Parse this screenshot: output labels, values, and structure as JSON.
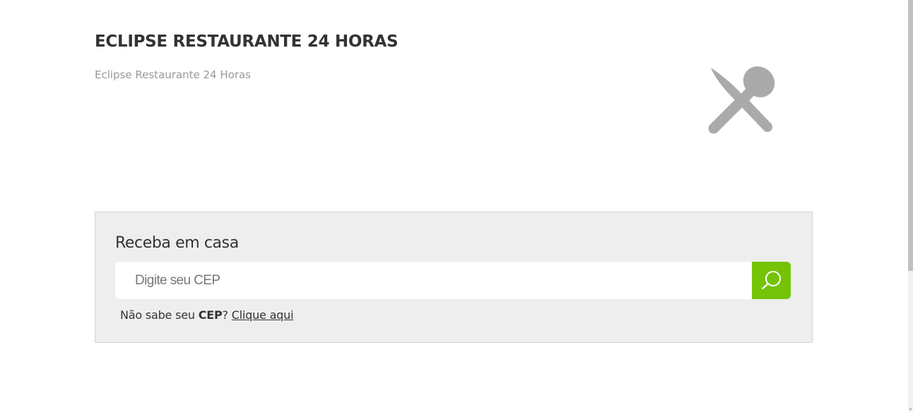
{
  "header": {
    "title": "ECLIPSE RESTAURANTE 24 HORAS",
    "subtitle": "Eclipse Restaurante 24 Horas",
    "logo_icon": "fork-spoon-crossed-icon",
    "logo_color": "#aaaaaa"
  },
  "delivery": {
    "title": "Receba em casa",
    "cep_placeholder": "Digite seu CEP",
    "cep_value": "",
    "search_icon": "search-icon",
    "search_button_color": "#74c306",
    "helper_prefix": "Não sabe seu ",
    "helper_bold": "CEP",
    "helper_question": "?",
    "helper_link": "Clique aqui"
  },
  "scrollbar": {
    "arrow_down": "⌄"
  }
}
